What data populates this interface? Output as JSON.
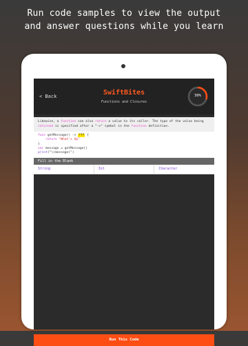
{
  "promo": {
    "line1": "Run code samples to view the output",
    "line2": "and answer questions while you learn"
  },
  "header": {
    "back_label": "< Back",
    "title": "SwiftBites",
    "subtitle": "Functions and Closures",
    "progress_label": "30%",
    "progress_value": 0.3
  },
  "description": {
    "parts": [
      "Likewise, a ",
      "function",
      " can also ",
      "return",
      " a value to its caller. The type of the value being ",
      "returned",
      " is specified after a \"->\" symbol in the ",
      "function",
      " definition."
    ]
  },
  "code": {
    "line1_kw": "func",
    "line1_text": " getMessage() -> ",
    "line1_blank": "???",
    "line1_end": " {",
    "line2_kw": "    return",
    "line2_str": " \"What's Up\"",
    "line3": "}",
    "line4_kw": "var",
    "line4_text": " message = getMessage()",
    "line5_fn": "print",
    "line5_text": "(\"\\(message)\")"
  },
  "fill_in": {
    "label": "Fill in the Blank",
    "options": [
      "String",
      "Int",
      "Character"
    ]
  },
  "run_button": {
    "label": "Run This Code"
  },
  "colors": {
    "accent": "#ff4e14",
    "keyword": "#c63ec8",
    "type": "#7a3fd0"
  }
}
